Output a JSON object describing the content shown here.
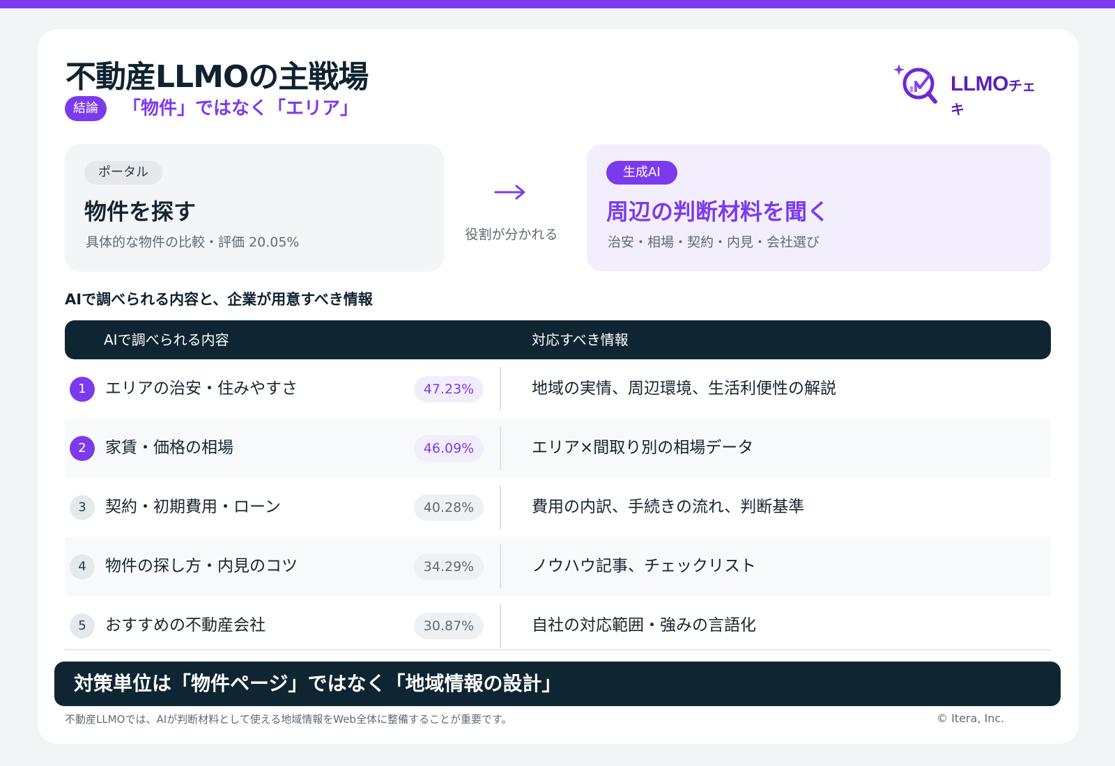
{
  "header": {
    "title": "不動産LLMOの主戦場",
    "conclusion_badge": "結論",
    "conclusion_text": "「物件」ではなく「エリア」"
  },
  "logo": {
    "brand": "LLMO",
    "brand_suffix": "チェキ",
    "accent_color": "#7c3aed"
  },
  "comparison": {
    "left": {
      "tag": "ポータル",
      "heading": "物件を探す",
      "sub": "具体的な物件の比較・評価  20.05%"
    },
    "arrow_caption": "役割が分かれる",
    "right": {
      "tag": "生成AI",
      "heading": "周辺の判断材料を聞く",
      "sub": "治安・相場・契約・内見・会社選び"
    }
  },
  "section_title": "AIで調べられる内容と、企業が用意すべき情報",
  "table": {
    "headers": [
      "AIで調べられる内容",
      "対応すべき情報"
    ],
    "rows": [
      {
        "rank": "1",
        "topic": "エリアの治安・住みやすさ",
        "pct": "47.23%",
        "answer": "地域の実情、周辺環境、生活利便性の解説",
        "highlight": true
      },
      {
        "rank": "2",
        "topic": "家賃・価格の相場",
        "pct": "46.09%",
        "answer": "エリア×間取り別の相場データ",
        "highlight": true
      },
      {
        "rank": "3",
        "topic": "契約・初期費用・ローン",
        "pct": "40.28%",
        "answer": "費用の内訳、手続きの流れ、判断基準",
        "highlight": false
      },
      {
        "rank": "4",
        "topic": "物件の探し方・内見のコツ",
        "pct": "34.29%",
        "answer": "ノウハウ記事、チェックリスト",
        "highlight": false
      },
      {
        "rank": "5",
        "topic": "おすすめの不動産会社",
        "pct": "30.87%",
        "answer": "自社の対応範囲・強みの言語化",
        "highlight": false
      }
    ]
  },
  "banner": "対策単位は「物件ページ」ではなく「地域情報の設計」",
  "footnote": "不動産LLMOでは、AIが判断材料として使える地域情報をWeb全体に整備することが重要です。",
  "copyright": "© Itera, Inc."
}
